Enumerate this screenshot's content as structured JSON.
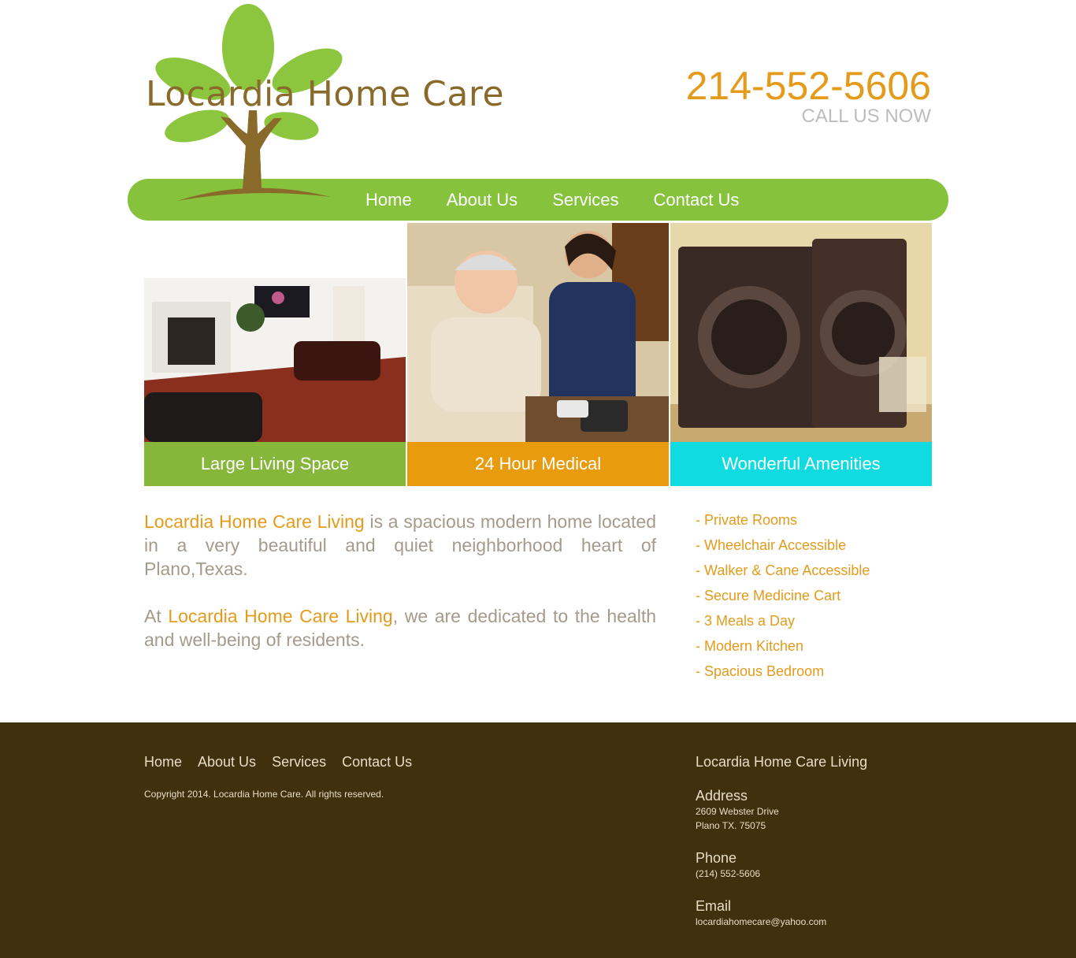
{
  "header": {
    "logo_text": "Locardia Home Care",
    "phone": "214-552-5606",
    "call_label": "CALL US NOW"
  },
  "nav": {
    "items": [
      {
        "label": "Home"
      },
      {
        "label": "About Us"
      },
      {
        "label": "Services"
      },
      {
        "label": "Contact Us"
      }
    ]
  },
  "panels": [
    {
      "caption": "Large Living Space",
      "color": "#86b63a"
    },
    {
      "caption": "24 Hour Medical",
      "color": "#e89b0d"
    },
    {
      "caption": "Wonderful Amenities",
      "color": "#10dbe0"
    }
  ],
  "intro": {
    "p1_highlight": "Locardia Home Care Living",
    "p1_rest": " is a spacious modern home located in a very beautiful and quiet neighborhood heart of Plano,Texas.",
    "p2_prefix": "At ",
    "p2_highlight": "Locardia Home Care Living",
    "p2_rest": ", we are dedicated to the health and well-being of residents."
  },
  "features": [
    "- Private Rooms",
    "- Wheelchair Accessible",
    "- Walker & Cane Accessible",
    "- Secure Medicine Cart",
    "- 3 Meals a Day",
    "- Modern Kitchen",
    "- Spacious Bedroom"
  ],
  "footer": {
    "links": [
      {
        "label": "Home"
      },
      {
        "label": "About Us"
      },
      {
        "label": "Services"
      },
      {
        "label": "Contact Us"
      }
    ],
    "copyright": "Copyright 2014. Locardia Home Care. All rights reserved.",
    "company": "Locardia Home Care Living",
    "address_head": "Address",
    "address_line1": "2609 Webster Drive",
    "address_line2": "Plano TX. 75075",
    "phone_head": "Phone",
    "phone_value": "(214) 552-5606",
    "email_head": "Email",
    "email_value": "locardiahomecare@yahoo.com"
  },
  "colors": {
    "brand_green": "#86c23c",
    "accent_orange": "#e49b1b",
    "footer_brown": "#40300e",
    "trunk_brown": "#8a6a2a"
  }
}
